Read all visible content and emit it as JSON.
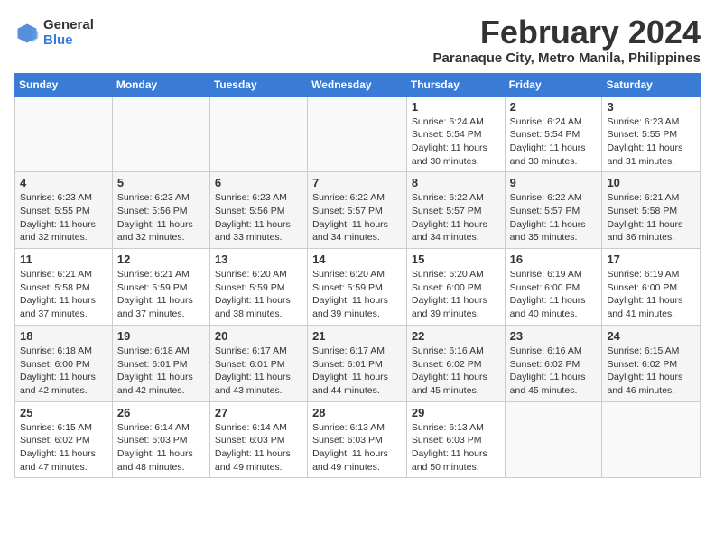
{
  "logo": {
    "general": "General",
    "blue": "Blue"
  },
  "title": {
    "month_year": "February 2024",
    "location": "Paranaque City, Metro Manila, Philippines"
  },
  "headers": [
    "Sunday",
    "Monday",
    "Tuesday",
    "Wednesday",
    "Thursday",
    "Friday",
    "Saturday"
  ],
  "weeks": [
    [
      {
        "day": "",
        "info": ""
      },
      {
        "day": "",
        "info": ""
      },
      {
        "day": "",
        "info": ""
      },
      {
        "day": "",
        "info": ""
      },
      {
        "day": "1",
        "info": "Sunrise: 6:24 AM\nSunset: 5:54 PM\nDaylight: 11 hours\nand 30 minutes."
      },
      {
        "day": "2",
        "info": "Sunrise: 6:24 AM\nSunset: 5:54 PM\nDaylight: 11 hours\nand 30 minutes."
      },
      {
        "day": "3",
        "info": "Sunrise: 6:23 AM\nSunset: 5:55 PM\nDaylight: 11 hours\nand 31 minutes."
      }
    ],
    [
      {
        "day": "4",
        "info": "Sunrise: 6:23 AM\nSunset: 5:55 PM\nDaylight: 11 hours\nand 32 minutes."
      },
      {
        "day": "5",
        "info": "Sunrise: 6:23 AM\nSunset: 5:56 PM\nDaylight: 11 hours\nand 32 minutes."
      },
      {
        "day": "6",
        "info": "Sunrise: 6:23 AM\nSunset: 5:56 PM\nDaylight: 11 hours\nand 33 minutes."
      },
      {
        "day": "7",
        "info": "Sunrise: 6:22 AM\nSunset: 5:57 PM\nDaylight: 11 hours\nand 34 minutes."
      },
      {
        "day": "8",
        "info": "Sunrise: 6:22 AM\nSunset: 5:57 PM\nDaylight: 11 hours\nand 34 minutes."
      },
      {
        "day": "9",
        "info": "Sunrise: 6:22 AM\nSunset: 5:57 PM\nDaylight: 11 hours\nand 35 minutes."
      },
      {
        "day": "10",
        "info": "Sunrise: 6:21 AM\nSunset: 5:58 PM\nDaylight: 11 hours\nand 36 minutes."
      }
    ],
    [
      {
        "day": "11",
        "info": "Sunrise: 6:21 AM\nSunset: 5:58 PM\nDaylight: 11 hours\nand 37 minutes."
      },
      {
        "day": "12",
        "info": "Sunrise: 6:21 AM\nSunset: 5:59 PM\nDaylight: 11 hours\nand 37 minutes."
      },
      {
        "day": "13",
        "info": "Sunrise: 6:20 AM\nSunset: 5:59 PM\nDaylight: 11 hours\nand 38 minutes."
      },
      {
        "day": "14",
        "info": "Sunrise: 6:20 AM\nSunset: 5:59 PM\nDaylight: 11 hours\nand 39 minutes."
      },
      {
        "day": "15",
        "info": "Sunrise: 6:20 AM\nSunset: 6:00 PM\nDaylight: 11 hours\nand 39 minutes."
      },
      {
        "day": "16",
        "info": "Sunrise: 6:19 AM\nSunset: 6:00 PM\nDaylight: 11 hours\nand 40 minutes."
      },
      {
        "day": "17",
        "info": "Sunrise: 6:19 AM\nSunset: 6:00 PM\nDaylight: 11 hours\nand 41 minutes."
      }
    ],
    [
      {
        "day": "18",
        "info": "Sunrise: 6:18 AM\nSunset: 6:00 PM\nDaylight: 11 hours\nand 42 minutes."
      },
      {
        "day": "19",
        "info": "Sunrise: 6:18 AM\nSunset: 6:01 PM\nDaylight: 11 hours\nand 42 minutes."
      },
      {
        "day": "20",
        "info": "Sunrise: 6:17 AM\nSunset: 6:01 PM\nDaylight: 11 hours\nand 43 minutes."
      },
      {
        "day": "21",
        "info": "Sunrise: 6:17 AM\nSunset: 6:01 PM\nDaylight: 11 hours\nand 44 minutes."
      },
      {
        "day": "22",
        "info": "Sunrise: 6:16 AM\nSunset: 6:02 PM\nDaylight: 11 hours\nand 45 minutes."
      },
      {
        "day": "23",
        "info": "Sunrise: 6:16 AM\nSunset: 6:02 PM\nDaylight: 11 hours\nand 45 minutes."
      },
      {
        "day": "24",
        "info": "Sunrise: 6:15 AM\nSunset: 6:02 PM\nDaylight: 11 hours\nand 46 minutes."
      }
    ],
    [
      {
        "day": "25",
        "info": "Sunrise: 6:15 AM\nSunset: 6:02 PM\nDaylight: 11 hours\nand 47 minutes."
      },
      {
        "day": "26",
        "info": "Sunrise: 6:14 AM\nSunset: 6:03 PM\nDaylight: 11 hours\nand 48 minutes."
      },
      {
        "day": "27",
        "info": "Sunrise: 6:14 AM\nSunset: 6:03 PM\nDaylight: 11 hours\nand 49 minutes."
      },
      {
        "day": "28",
        "info": "Sunrise: 6:13 AM\nSunset: 6:03 PM\nDaylight: 11 hours\nand 49 minutes."
      },
      {
        "day": "29",
        "info": "Sunrise: 6:13 AM\nSunset: 6:03 PM\nDaylight: 11 hours\nand 50 minutes."
      },
      {
        "day": "",
        "info": ""
      },
      {
        "day": "",
        "info": ""
      }
    ]
  ]
}
